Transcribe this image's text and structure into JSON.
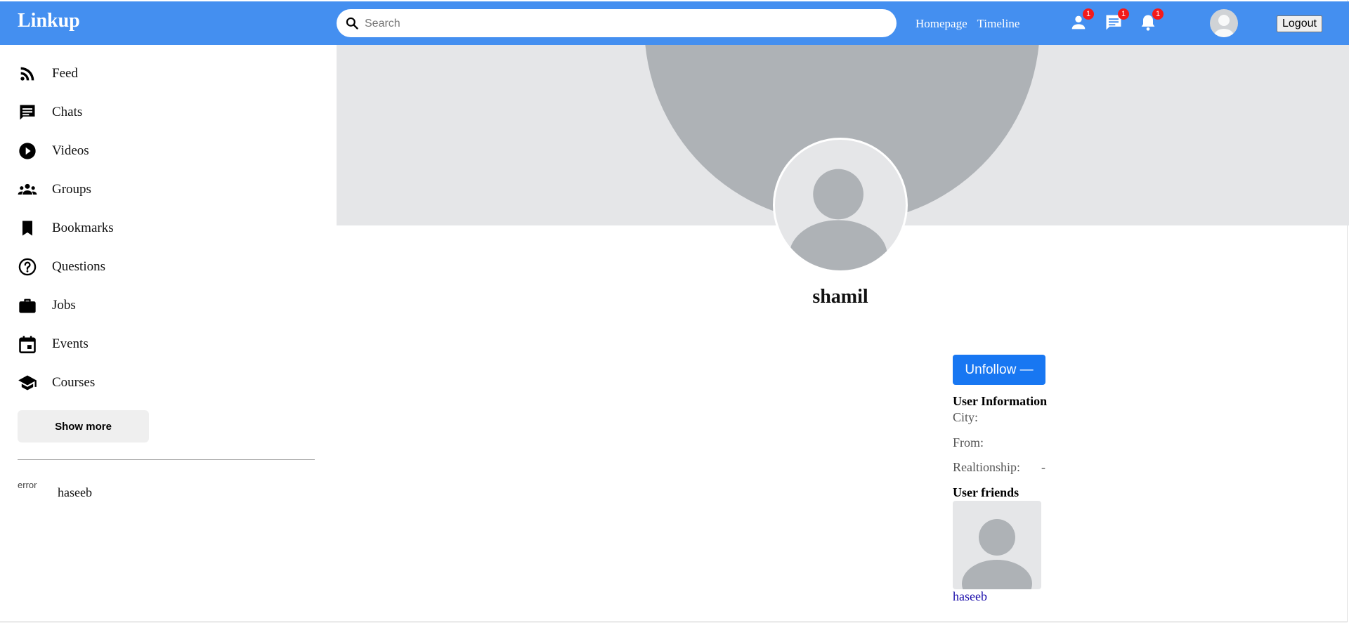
{
  "app": {
    "title": "Linkup"
  },
  "search": {
    "placeholder": "Search"
  },
  "nav_links": {
    "homepage": "Homepage",
    "timeline": "Timeline"
  },
  "notifications": {
    "friends": {
      "icon": "person-icon",
      "count": "1"
    },
    "messages": {
      "icon": "chat-icon",
      "count": "1"
    },
    "alerts": {
      "icon": "bell-icon",
      "count": "1"
    }
  },
  "logout_label": "Logout",
  "sidebar": {
    "items": [
      {
        "label": "Feed",
        "icon": "rss-icon"
      },
      {
        "label": "Chats",
        "icon": "chat-icon"
      },
      {
        "label": "Videos",
        "icon": "play-circle-icon"
      },
      {
        "label": "Groups",
        "icon": "group-icon"
      },
      {
        "label": "Bookmarks",
        "icon": "bookmark-icon"
      },
      {
        "label": "Questions",
        "icon": "help-circle-icon"
      },
      {
        "label": "Jobs",
        "icon": "briefcase-icon"
      },
      {
        "label": "Events",
        "icon": "calendar-icon"
      },
      {
        "label": "Courses",
        "icon": "school-icon"
      }
    ],
    "show_more_label": "Show more",
    "friends": [
      {
        "name": "haseeb",
        "image_alt": "error"
      }
    ]
  },
  "profile": {
    "name": "shamil",
    "unfollow_label": "Unfollow —",
    "info_title": "User Information",
    "city_label": "City:",
    "city_value": "",
    "from_label": "From:",
    "from_value": "",
    "relationship_label": "Realtionship:",
    "relationship_value": "-",
    "friends_title": "User friends",
    "friends": [
      {
        "name": "haseeb"
      }
    ]
  },
  "colors": {
    "topbar": "#448ff0",
    "button": "#1877f2",
    "badge": "#f41a1a",
    "placeholder_bg": "#e5e6e8",
    "placeholder_fg": "#aeb2b6"
  }
}
